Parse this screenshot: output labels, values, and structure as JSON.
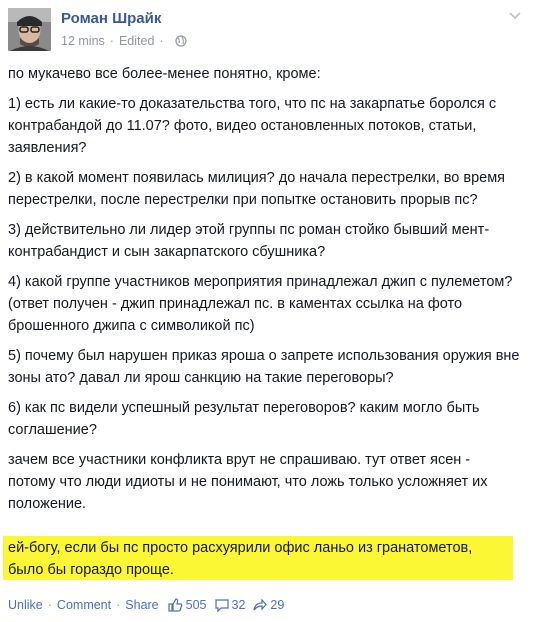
{
  "author": {
    "name": "Роман Шрайк"
  },
  "meta": {
    "time": "12 mins",
    "edited": "Edited"
  },
  "paragraphs": [
    "по мукачево все более-менее понятно, кроме:",
    "1) есть ли какие-то доказательства того, что пс на закарпатье боролся с контрабандой до 11.07? фото, видео остановленных потоков, статьи, заявления?",
    "2) в какой момент появилась милиция? до начала перестрелки, во время перестрелки, после перестрелки при попытке остановить прорыв пс?",
    "3) действительно ли лидер этой группы пс роман стойко бывший мент-контрабандист и сын закарпатского сбушника?",
    "4) какой группе участников мероприятия принадлежал джип с пулеметом?",
    "(ответ получен - джип принадлежал пс. в каментах ссылка на фото брошенного джипа с символикой пс)",
    "5) почему был нарушен приказ яроша о запрете использования оружия вне зоны ато? давал ли ярош санкцию на такие переговоры?",
    "6) как пс видели успешный результат переговоров? каким могло быть соглашение?",
    "зачем все участники конфликта врут не спрашиваю. тут ответ ясен - потому что люди идиоты и не понимают, что ложь только усложняет их положение."
  ],
  "highlight": {
    "line1": "ей-богу, если бы пс просто расхуярили офис ланьо из гранатометов,",
    "line2": "было бы гораздо проще.",
    "color": "#fbf735"
  },
  "actions": {
    "unlike": "Unlike",
    "comment": "Comment",
    "share": "Share",
    "likes": "505",
    "comments": "32",
    "shares": "29"
  },
  "colors": {
    "link": "#3b5998",
    "muted": "#9197a3",
    "text": "#141823"
  }
}
